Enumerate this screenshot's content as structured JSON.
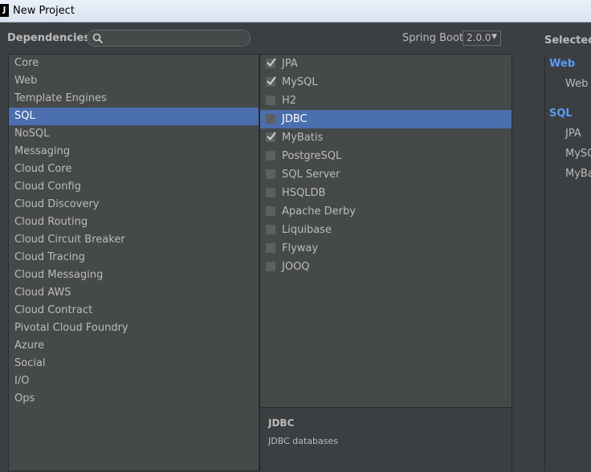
{
  "window": {
    "title": "New Project",
    "app_icon_glyph": "J"
  },
  "toolbar": {
    "dependencies_label": "Dependencies",
    "search_placeholder": "",
    "spring_boot_label": "Spring Boot",
    "spring_boot_version": "2.0.0"
  },
  "categories": [
    {
      "label": "Core",
      "selected": false
    },
    {
      "label": "Web",
      "selected": false
    },
    {
      "label": "Template Engines",
      "selected": false
    },
    {
      "label": "SQL",
      "selected": true
    },
    {
      "label": "NoSQL",
      "selected": false
    },
    {
      "label": "Messaging",
      "selected": false
    },
    {
      "label": "Cloud Core",
      "selected": false
    },
    {
      "label": "Cloud Config",
      "selected": false
    },
    {
      "label": "Cloud Discovery",
      "selected": false
    },
    {
      "label": "Cloud Routing",
      "selected": false
    },
    {
      "label": "Cloud Circuit Breaker",
      "selected": false
    },
    {
      "label": "Cloud Tracing",
      "selected": false
    },
    {
      "label": "Cloud Messaging",
      "selected": false
    },
    {
      "label": "Cloud AWS",
      "selected": false
    },
    {
      "label": "Cloud Contract",
      "selected": false
    },
    {
      "label": "Pivotal Cloud Foundry",
      "selected": false
    },
    {
      "label": "Azure",
      "selected": false
    },
    {
      "label": "Social",
      "selected": false
    },
    {
      "label": "I/O",
      "selected": false
    },
    {
      "label": "Ops",
      "selected": false
    }
  ],
  "dependencies": [
    {
      "label": "JPA",
      "checked": true,
      "selected": false
    },
    {
      "label": "MySQL",
      "checked": true,
      "selected": false
    },
    {
      "label": "H2",
      "checked": false,
      "selected": false
    },
    {
      "label": "JDBC",
      "checked": false,
      "selected": true
    },
    {
      "label": "MyBatis",
      "checked": true,
      "selected": false
    },
    {
      "label": "PostgreSQL",
      "checked": false,
      "selected": false
    },
    {
      "label": "SQL Server",
      "checked": false,
      "selected": false
    },
    {
      "label": "HSQLDB",
      "checked": false,
      "selected": false
    },
    {
      "label": "Apache Derby",
      "checked": false,
      "selected": false
    },
    {
      "label": "Liquibase",
      "checked": false,
      "selected": false
    },
    {
      "label": "Flyway",
      "checked": false,
      "selected": false
    },
    {
      "label": "JOOQ",
      "checked": false,
      "selected": false
    }
  ],
  "description": {
    "title": "JDBC",
    "text": "JDBC databases"
  },
  "selected_panel": {
    "header": "Selected D",
    "groups": [
      {
        "name": "Web",
        "items": [
          "Web"
        ]
      },
      {
        "name": "SQL",
        "items": [
          "JPA",
          "MySQL",
          "MyBatis"
        ]
      }
    ]
  },
  "colors": {
    "background": "#3c3f41",
    "list_background": "#45494a",
    "selection": "#4b6eaf",
    "group_heading": "#589df6",
    "text": "#bbbbbb"
  }
}
